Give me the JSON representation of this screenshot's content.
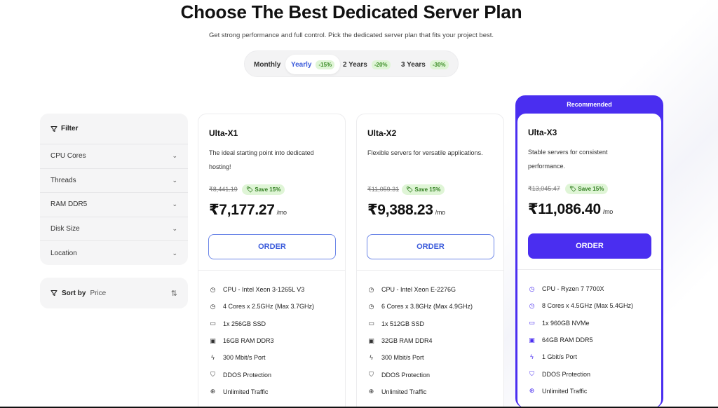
{
  "header": {
    "title": "Choose The Best Dedicated Server Plan",
    "subtitle": "Get strong performance and full control. Pick the dedicated server plan that fits your project best."
  },
  "billing": {
    "options": [
      {
        "label": "Monthly",
        "discount": ""
      },
      {
        "label": "Yearly",
        "discount": "-15%"
      },
      {
        "label": "2 Years",
        "discount": "-20%"
      },
      {
        "label": "3 Years",
        "discount": "-30%"
      }
    ],
    "selected": "Yearly"
  },
  "filter": {
    "title": "Filter",
    "items": [
      "CPU Cores",
      "Threads",
      "RAM DDR5",
      "Disk Size",
      "Location"
    ]
  },
  "sort": {
    "label": "Sort by",
    "value": "Price"
  },
  "recommended_label": "Recommended",
  "plans": [
    {
      "name": "Ulta-X1",
      "description": "The ideal starting point into dedicated hosting!",
      "old_price": "₹8,441.19",
      "save": "Save 15%",
      "price": "₹7,177.27",
      "period": "/mo",
      "order": "ORDER",
      "features": [
        "CPU - Intel Xeon 3-1265L V3",
        "4 Cores x 2.5GHz (Max 3.7GHz)",
        "1x 256GB SSD",
        "16GB RAM DDR3",
        "300 Mbit/s Port",
        "DDOS Protection",
        "Unlimited Traffic"
      ]
    },
    {
      "name": "Ulta-X2",
      "description": "Flexible servers for versatile applications.",
      "old_price": "₹11,059.31",
      "save": "Save 15%",
      "price": "₹9,388.23",
      "period": "/mo",
      "order": "ORDER",
      "features": [
        "CPU - Intel Xeon E-2276G",
        "6 Cores x 3.8GHz (Max 4.9GHz)",
        "1x 512GB SSD",
        "32GB RAM DDR4",
        "300 Mbit/s Port",
        "DDOS Protection",
        "Unlimited Traffic"
      ]
    },
    {
      "name": "Ulta-X3",
      "description": "Stable servers for consistent performance.",
      "old_price": "₹13,045.47",
      "save": "Save 15%",
      "price": "₹11,086.40",
      "period": "/mo",
      "order": "ORDER",
      "features": [
        "CPU - Ryzen 7 7700X",
        "8 Cores x 4.5GHz (Max 5.4GHz)",
        "1x 960GB NVMe",
        "64GB RAM DDR5",
        "1 Gbit/s Port",
        "DDOS Protection",
        "Unlimited Traffic"
      ]
    }
  ],
  "feature_icons": [
    "cpu-icon",
    "cores-icon",
    "disk-icon",
    "ram-icon",
    "port-icon",
    "shield-icon",
    "globe-icon"
  ],
  "colors": {
    "accent": "#4a2ef0",
    "link": "#3b5bdb",
    "save_bg": "#dff5d6",
    "save_text": "#2f7d1e"
  }
}
